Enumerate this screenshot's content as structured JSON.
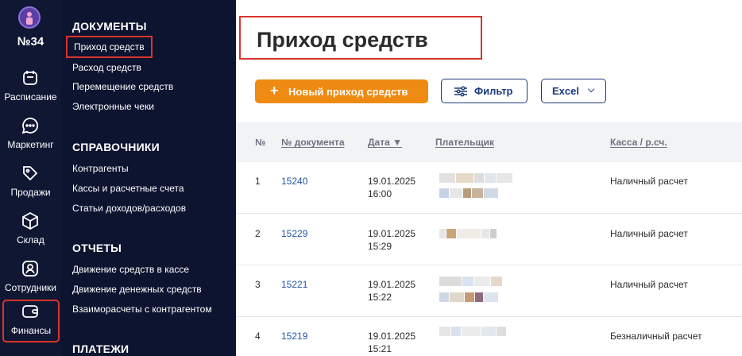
{
  "rail": {
    "number": "№34",
    "items": [
      {
        "label": "Расписание",
        "icon": "calendar-icon"
      },
      {
        "label": "Маркетинг",
        "icon": "chat-icon"
      },
      {
        "label": "Продажи",
        "icon": "tag-icon"
      },
      {
        "label": "Склад",
        "icon": "box-icon"
      },
      {
        "label": "Сотрудники",
        "icon": "person-icon"
      },
      {
        "label": "Финансы",
        "icon": "wallet-icon"
      }
    ]
  },
  "nav": {
    "sections": [
      {
        "title": "ДОКУМЕНТЫ",
        "links": [
          "Приход средств",
          "Расход средств",
          "Перемещение средств",
          "Электронные чеки"
        ]
      },
      {
        "title": "СПРАВОЧНИКИ",
        "links": [
          "Контрагенты",
          "Кассы и расчетные счета",
          "Статьи доходов/расходов"
        ]
      },
      {
        "title": "ОТЧЕТЫ",
        "links": [
          "Движение средств в кассе",
          "Движение денежных средств",
          "Взаиморасчеты с контрагентом"
        ]
      },
      {
        "title": "ПЛАТЕЖИ",
        "links": []
      }
    ]
  },
  "main": {
    "title": "Приход средств",
    "new_button": "Новый приход средств",
    "filter_button": "Фильтр",
    "excel_button": "Excel",
    "columns": [
      "№",
      "№ документа",
      "Дата ▼",
      "Плательщик",
      "Касса / р.сч."
    ],
    "rows": [
      {
        "n": "1",
        "doc": "15240",
        "date": "19.01.2025",
        "time": "16:00",
        "cash": "Наличный расчет"
      },
      {
        "n": "2",
        "doc": "15229",
        "date": "19.01.2025",
        "time": "15:29",
        "cash": "Наличный расчет"
      },
      {
        "n": "3",
        "doc": "15221",
        "date": "19.01.2025",
        "time": "15:22",
        "cash": "Наличный расчет"
      },
      {
        "n": "4",
        "doc": "15219",
        "date": "19.01.2025",
        "time": "15:21",
        "cash": "Безналичный расчет"
      }
    ]
  }
}
